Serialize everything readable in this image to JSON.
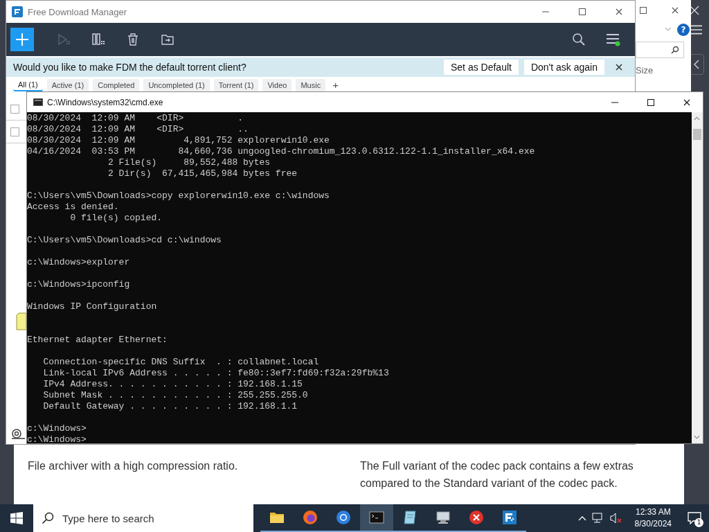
{
  "browser": {
    "texts": [
      "File archiver with a high compression ratio.",
      "The Full variant of the codec pack contains a few extras compared to the Standard variant of the codec pack."
    ]
  },
  "explorer": {
    "column": "Size",
    "help": "?"
  },
  "fdm": {
    "title": "Free Download Manager",
    "banner": {
      "text": "Would you like to make FDM the default torrent client?",
      "buttons": [
        "Set as Default",
        "Don't ask again"
      ]
    },
    "tabs": [
      {
        "label": "All (1)",
        "selected": true
      },
      {
        "label": "Active (1)",
        "selected": false
      },
      {
        "label": "Completed",
        "selected": false
      },
      {
        "label": "Uncompleted (1)",
        "selected": false
      },
      {
        "label": "Torrent (1)",
        "selected": false
      },
      {
        "label": "Video",
        "selected": false
      },
      {
        "label": "Music",
        "selected": false
      }
    ],
    "add_tab": "+",
    "rows": [
      {
        "checked": false
      },
      {
        "checked": false
      }
    ]
  },
  "cmd": {
    "title": "C:\\Windows\\system32\\cmd.exe",
    "blocks": [
      "08/30/2024  12:09 AM    <DIR>          .\n08/30/2024  12:09 AM    <DIR>          ..\n08/30/2024  12:09 AM         4,891,752 explorerwin10.exe\n04/16/2024  03:53 PM        84,660,736 ungoogled-chromium_123.0.6312.122-1.1_installer_x64.exe\n               2 File(s)     89,552,488 bytes\n               2 Dir(s)  67,415,465,984 bytes free",
      "C:\\Users\\vm5\\Downloads>copy explorerwin10.exe c:\\windows\nAccess is denied.\n        0 file(s) copied.",
      "C:\\Users\\vm5\\Downloads>cd c:\\windows",
      "c:\\Windows>explorer",
      "c:\\Windows>ipconfig",
      "Windows IP Configuration",
      "\nEthernet adapter Ethernet:",
      "   Connection-specific DNS Suffix  . : collabnet.local\n   Link-local IPv6 Address . . . . . : fe80::3ef7:fd69:f32a:29fb%13\n   IPv4 Address. . . . . . . . . . . : 192.168.1.15\n   Subnet Mask . . . . . . . . . . . : 255.255.255.0\n   Default Gateway . . . . . . . . . : 192.168.1.1",
      "c:\\Windows>\nc:\\Windows>"
    ]
  },
  "taskbar": {
    "search_placeholder": "Type here to search",
    "apps": [
      {
        "kind": "folder",
        "selected": false
      },
      {
        "kind": "firefox",
        "selected": false
      },
      {
        "kind": "chrome",
        "selected": false
      },
      {
        "kind": "terminal",
        "selected": true
      },
      {
        "kind": "notepad",
        "selected": false
      },
      {
        "kind": "computer",
        "selected": false
      },
      {
        "kind": "error",
        "selected": false
      },
      {
        "kind": "fdm",
        "selected": false
      }
    ],
    "time": "12:33 AM",
    "date": "8/30/2024",
    "notifications": "1"
  }
}
